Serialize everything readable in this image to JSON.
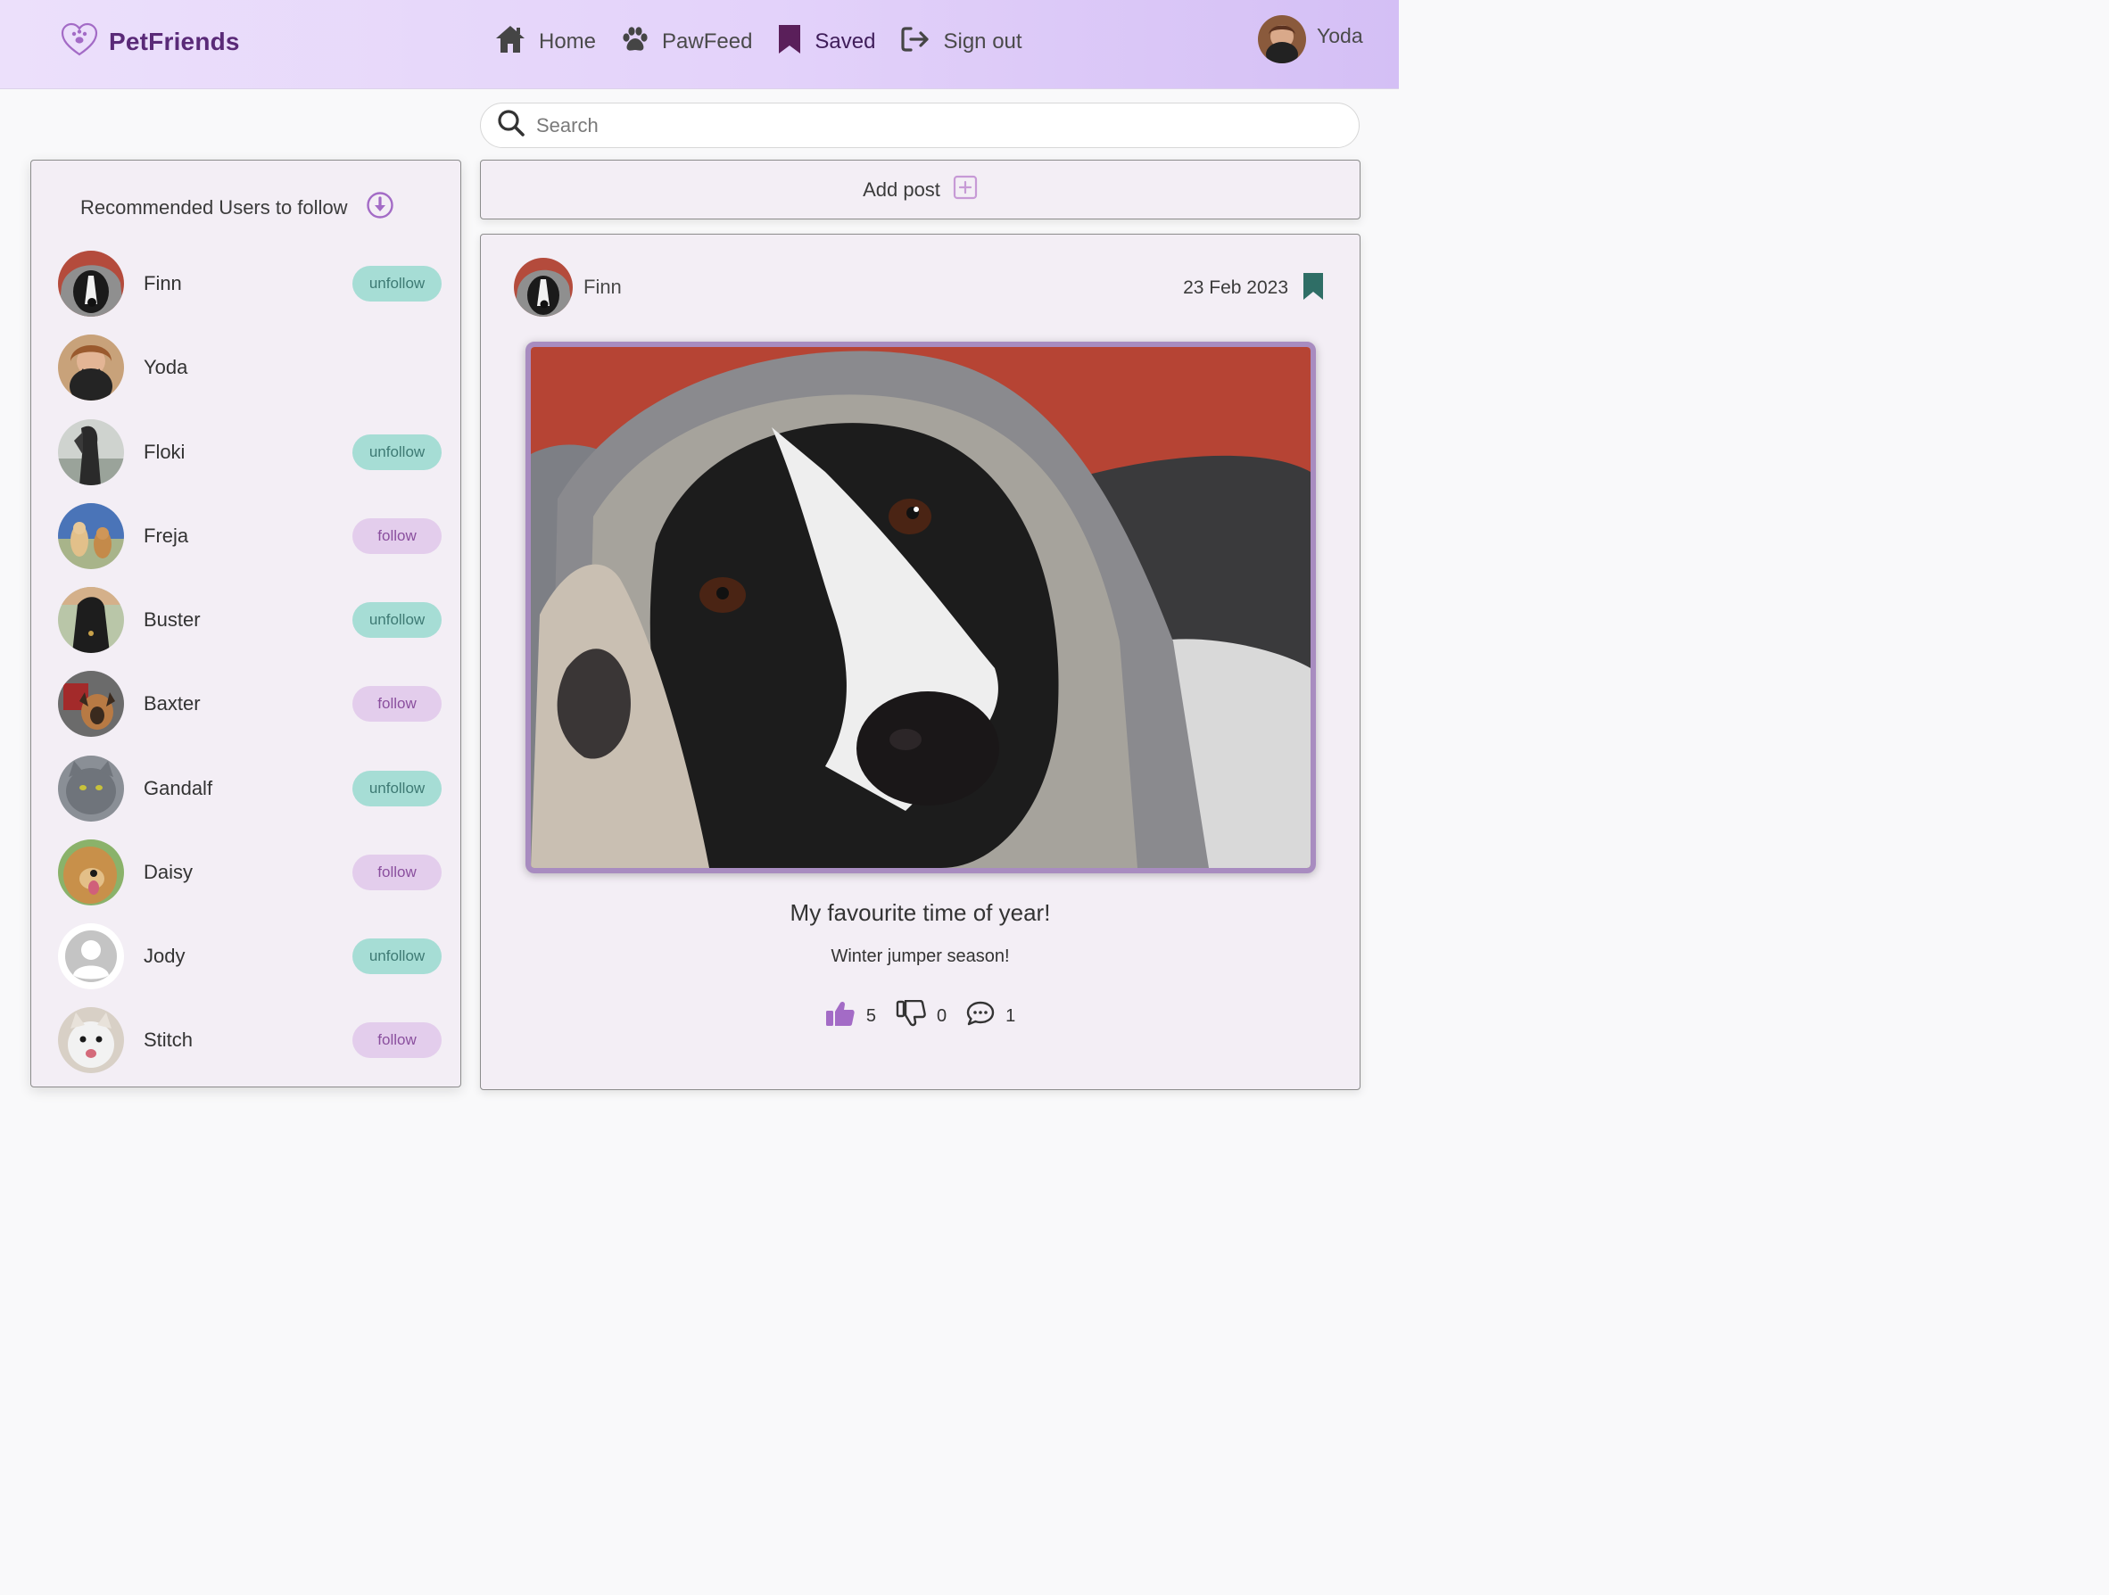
{
  "brand": {
    "name": "PetFriends"
  },
  "nav": {
    "items": [
      {
        "label": "Home",
        "icon": "home-icon"
      },
      {
        "label": "PawFeed",
        "icon": "paw-icon"
      },
      {
        "label": "Saved",
        "icon": "bookmark-icon"
      },
      {
        "label": "Sign out",
        "icon": "sign-out-icon"
      }
    ],
    "user_name": "Yoda"
  },
  "search": {
    "placeholder": "Search",
    "value": ""
  },
  "sidebar": {
    "title": "Recommended Users to follow",
    "users": [
      {
        "name": "Finn",
        "action": "unfollow"
      },
      {
        "name": "Yoda",
        "action": ""
      },
      {
        "name": "Floki",
        "action": "unfollow"
      },
      {
        "name": "Freja",
        "action": "follow"
      },
      {
        "name": "Buster",
        "action": "unfollow"
      },
      {
        "name": "Baxter",
        "action": "follow"
      },
      {
        "name": "Gandalf",
        "action": "unfollow"
      },
      {
        "name": "Daisy",
        "action": "follow"
      },
      {
        "name": "Jody",
        "action": "unfollow"
      },
      {
        "name": "Stitch",
        "action": "follow"
      }
    ]
  },
  "add_post": {
    "label": "Add post"
  },
  "post": {
    "author": "Finn",
    "date": "23 Feb 2023",
    "title": "My favourite time of year!",
    "text": "Winter jumper season!",
    "likes": "5",
    "dislikes": "0",
    "comments": "1"
  },
  "colors": {
    "brand": "#5a2a78",
    "unfollow_bg": "#a6ddd5",
    "follow_bg": "#e3cdec",
    "accent": "#a36bc6",
    "bookmark_teal": "#2f6e66"
  }
}
